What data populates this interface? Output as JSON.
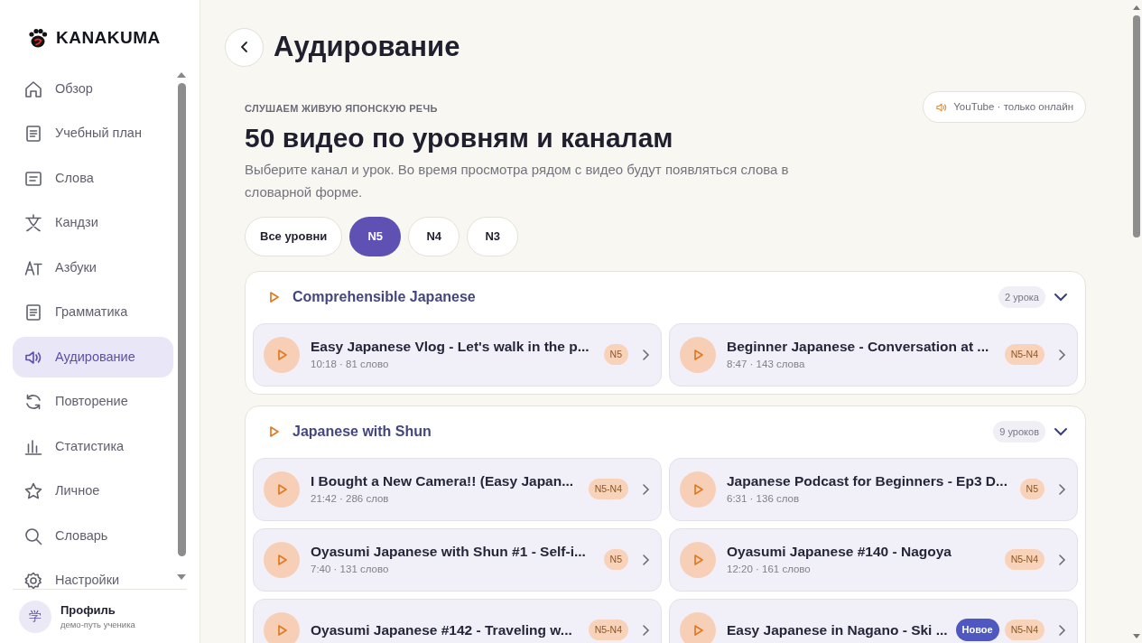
{
  "brand": {
    "name": "KANAKUMA"
  },
  "nav": [
    {
      "label": "Обзор",
      "kind": "home",
      "selected": false
    },
    {
      "label": "Учебный план",
      "kind": "doc",
      "selected": false
    },
    {
      "label": "Слова",
      "kind": "list",
      "selected": false
    },
    {
      "label": "Кандзи",
      "kind": "kanji",
      "selected": false
    },
    {
      "label": "Азбуки",
      "kind": "kana",
      "selected": false
    },
    {
      "label": "Грамматика",
      "kind": "doc",
      "selected": false
    },
    {
      "label": "Аудирование",
      "kind": "speaker",
      "selected": true
    },
    {
      "label": "Повторение",
      "kind": "refresh",
      "selected": false
    },
    {
      "label": "Статистика",
      "kind": "chart",
      "selected": false
    },
    {
      "label": "Личное",
      "kind": "star",
      "selected": false
    },
    {
      "label": "Словарь",
      "kind": "search",
      "selected": false
    },
    {
      "label": "Настройки",
      "kind": "gear",
      "selected": false
    }
  ],
  "profile": {
    "avatar": "学",
    "name": "Профиль",
    "subtitle": "демо-путь ученика"
  },
  "page": {
    "title": "Аудирование"
  },
  "hero": {
    "eyebrow": "СЛУШАЕМ ЖИВУЮ ЯПОНСКУЮ РЕЧЬ",
    "heading": "50 видео по уровням и каналам",
    "description": "Выберите канал и урок. Во время просмотра рядом с видео будут появляться слова в словарной форме.",
    "note": "YouTube · только онлайн"
  },
  "filters": [
    {
      "label": "Все уровни",
      "selected": false
    },
    {
      "label": "N5",
      "selected": true
    },
    {
      "label": "N4",
      "selected": false
    },
    {
      "label": "N3",
      "selected": false
    }
  ],
  "channels": [
    {
      "title": "Comprehensible Japanese",
      "count": "2 урока",
      "expanded": true,
      "videos": [
        {
          "title": "Easy Japanese Vlog - Let's walk in the p...",
          "meta": "10:18 · 81 слово",
          "level": "N5"
        },
        {
          "title": "Beginner Japanese - Conversation at ...",
          "meta": "8:47 · 143 слова",
          "level": "N5-N4"
        }
      ]
    },
    {
      "title": "Japanese with Shun",
      "count": "9 уроков",
      "expanded": true,
      "videos": [
        {
          "title": "I Bought a New Camera!! (Easy Japan...",
          "meta": "21:42 · 286 слов",
          "level": "N5-N4"
        },
        {
          "title": "Japanese Podcast for Beginners - Ep3 D...",
          "meta": "6:31 · 136 слов",
          "level": "N5"
        },
        {
          "title": "Oyasumi Japanese with Shun #1 - Self-i...",
          "meta": "7:40 · 131 слово",
          "level": "N5"
        },
        {
          "title": "Oyasumi Japanese #140 - Nagoya",
          "meta": "12:20 · 161 слово",
          "level": "N5-N4"
        },
        {
          "title": "Oyasumi Japanese #142 - Traveling w...",
          "level": "N5-N4"
        },
        {
          "title": "Easy Japanese in Nagano - Ski ...",
          "level": "N5-N4",
          "badge": "Новое"
        }
      ]
    }
  ]
}
